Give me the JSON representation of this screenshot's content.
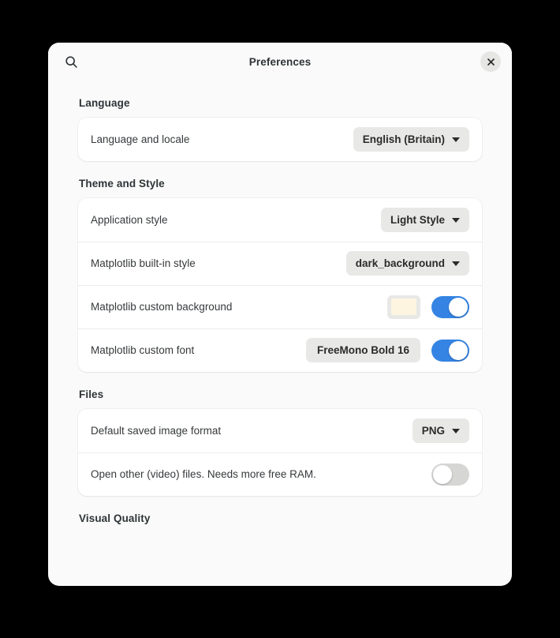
{
  "window": {
    "title": "Preferences",
    "search_icon": "search-icon",
    "close_icon": "close-icon",
    "bg_color": "#fafafa",
    "card_color": "#ffffff",
    "accent_color": "#3584e4",
    "backdrop_color": "#000000"
  },
  "sections": [
    {
      "title": "Language",
      "rows": [
        {
          "label": "Language and locale",
          "control": "dropdown",
          "value": "English (Britain)"
        }
      ]
    },
    {
      "title": "Theme and Style",
      "rows": [
        {
          "label": "Application style",
          "control": "dropdown",
          "value": "Light Style"
        },
        {
          "label": "Matplotlib built-in style",
          "control": "dropdown",
          "value": "dark_background"
        },
        {
          "label": "Matplotlib custom background",
          "control": "swatch-toggle",
          "swatch_color": "#fdf5e0",
          "toggle": "on"
        },
        {
          "label": "Matplotlib custom font",
          "control": "button-toggle",
          "value": "FreeMono Bold  16",
          "toggle": "on"
        }
      ]
    },
    {
      "title": "Files",
      "rows": [
        {
          "label": "Default saved image format",
          "control": "dropdown",
          "value": "PNG"
        },
        {
          "label": "Open other (video) files. Needs more free RAM.",
          "control": "toggle",
          "toggle": "off"
        }
      ]
    },
    {
      "title": "Visual Quality",
      "rows": []
    }
  ]
}
